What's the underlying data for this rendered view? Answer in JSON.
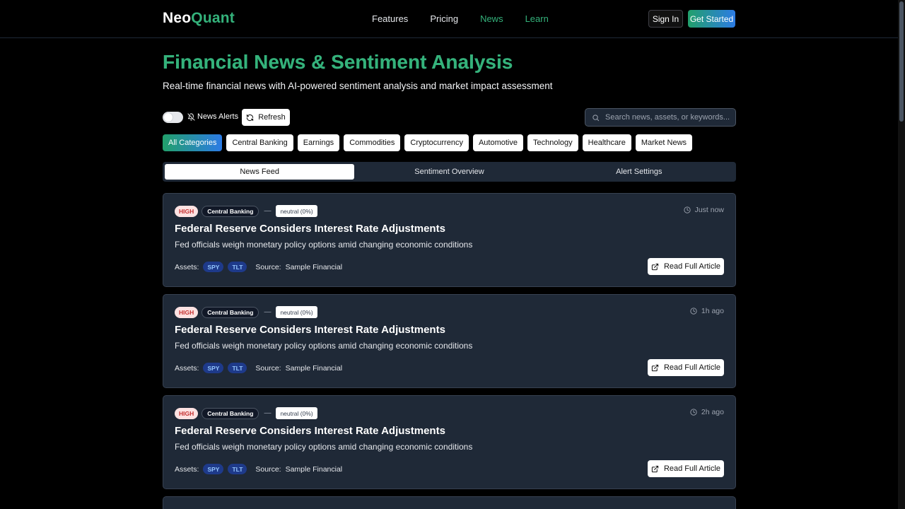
{
  "nav": {
    "logo_a": "Neo",
    "logo_b": "Quant",
    "links": [
      "Features",
      "Pricing",
      "News",
      "Learn"
    ],
    "sign_in": "Sign In",
    "get_started": "Get Started"
  },
  "page": {
    "title": "Financial News & Sentiment Analysis",
    "subtitle": "Real-time financial news with AI-powered sentiment analysis and market impact assessment"
  },
  "controls": {
    "alerts_label": "News Alerts",
    "alerts_enabled": false,
    "refresh_label": "Refresh",
    "search_placeholder": "Search news, assets, or keywords..."
  },
  "categories": [
    "All Categories",
    "Central Banking",
    "Earnings",
    "Commodities",
    "Cryptocurrency",
    "Automotive",
    "Technology",
    "Healthcare",
    "Market News"
  ],
  "tabs": [
    "News Feed",
    "Sentiment Overview",
    "Alert Settings"
  ],
  "articles": [
    {
      "impact": "HIGH",
      "category": "Central Banking",
      "dash": "—",
      "sentiment": "neutral (0%)",
      "time": "Just now",
      "headline": "Federal Reserve Considers Interest Rate Adjustments",
      "summary": "Fed officials weigh monetary policy options amid changing economic conditions",
      "assets_label": "Assets:",
      "assets": [
        "SPY",
        "TLT"
      ],
      "source_label": "Source:",
      "source": "Sample Financial",
      "read_label": "Read Full Article"
    },
    {
      "impact": "HIGH",
      "category": "Central Banking",
      "dash": "—",
      "sentiment": "neutral (0%)",
      "time": "1h ago",
      "headline": "Federal Reserve Considers Interest Rate Adjustments",
      "summary": "Fed officials weigh monetary policy options amid changing economic conditions",
      "assets_label": "Assets:",
      "assets": [
        "SPY",
        "TLT"
      ],
      "source_label": "Source:",
      "source": "Sample Financial",
      "read_label": "Read Full Article"
    },
    {
      "impact": "HIGH",
      "category": "Central Banking",
      "dash": "—",
      "sentiment": "neutral (0%)",
      "time": "2h ago",
      "headline": "Federal Reserve Considers Interest Rate Adjustments",
      "summary": "Fed officials weigh monetary policy options amid changing economic conditions",
      "assets_label": "Assets:",
      "assets": [
        "SPY",
        "TLT"
      ],
      "source_label": "Source:",
      "source": "Sample Financial",
      "read_label": "Read Full Article"
    }
  ],
  "colors": {
    "accent_green": "#34b27b",
    "accent_blue": "#2c7be5",
    "card_bg": "#1f2937",
    "high_badge": "#c53030"
  }
}
